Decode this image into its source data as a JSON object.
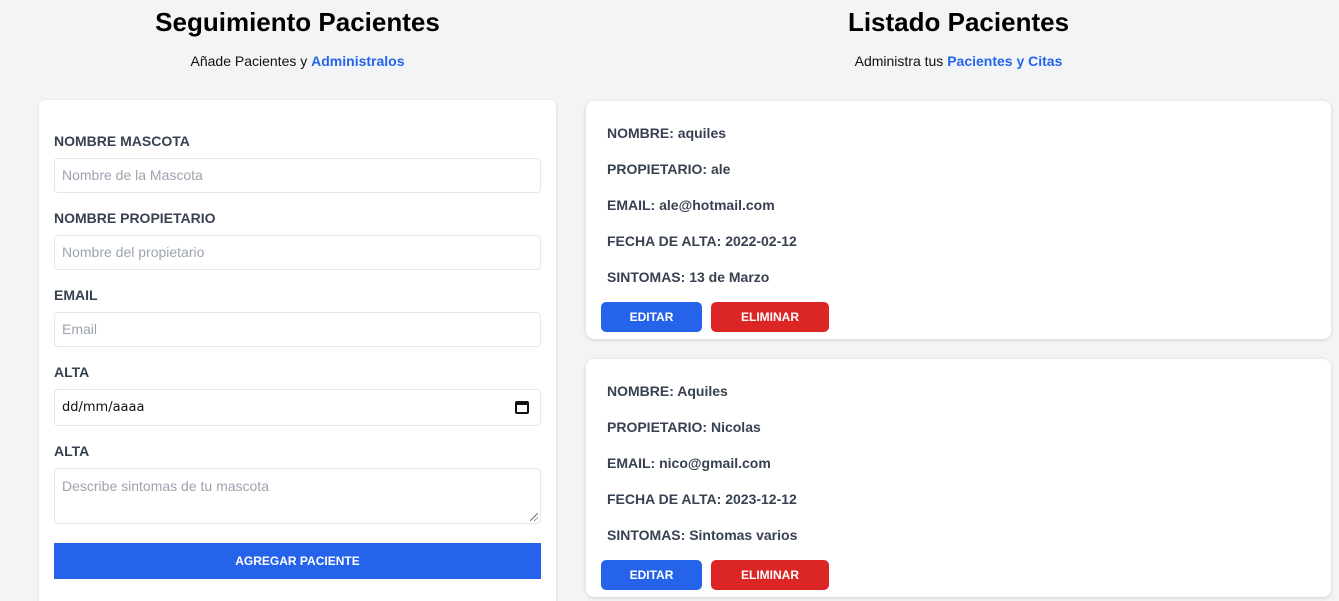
{
  "form_section": {
    "title": "Seguimiento Pacientes",
    "subtitle_prefix": "Añade Pacientes y",
    "subtitle_accent": "Administralos",
    "fields": {
      "pet_name": {
        "label": "Nombre Mascota",
        "placeholder": "Nombre de la Mascota"
      },
      "owner_name": {
        "label": "Nombre Propietario",
        "placeholder": "Nombre del propietario"
      },
      "email": {
        "label": "Email",
        "placeholder": "Email"
      },
      "discharge_date": {
        "label": "Alta",
        "value": "dd/mm/aaaa"
      },
      "symptoms": {
        "label": "Alta",
        "placeholder": "Describe sintomas de tu mascota"
      }
    },
    "submit_label": "Agregar Paciente"
  },
  "list_section": {
    "title": "Listado Pacientes",
    "subtitle_prefix": "Administra tus",
    "subtitle_accent": "Pacientes y Citas",
    "patients": [
      {
        "name_label": "Nombre:",
        "name": "aquiles",
        "owner_label": "Propietario:",
        "owner": "ale",
        "email_label": "Email:",
        "email": "ale@hotmail.com",
        "date_label": "Fecha de Alta:",
        "date": "2022-02-12",
        "symptoms_label": "Sintomas:",
        "symptoms": "13 de Marzo",
        "edit_label": "Editar",
        "delete_label": "Eliminar"
      },
      {
        "name_label": "Nombre:",
        "name": "Aquiles",
        "owner_label": "Propietario:",
        "owner": "Nicolas",
        "email_label": "Email:",
        "email": "nico@gmail.com",
        "date_label": "Fecha de Alta:",
        "date": "2023-12-12",
        "symptoms_label": "Sintomas:",
        "symptoms": "Sintomas varios",
        "edit_label": "Editar",
        "delete_label": "Eliminar"
      }
    ]
  },
  "colors": {
    "accent": "#2563eb",
    "danger": "#dc2626",
    "background": "#f3f4f6"
  },
  "icons": {
    "date_picker": "calendar-icon",
    "textarea_resize": "resize-handle-icon"
  }
}
